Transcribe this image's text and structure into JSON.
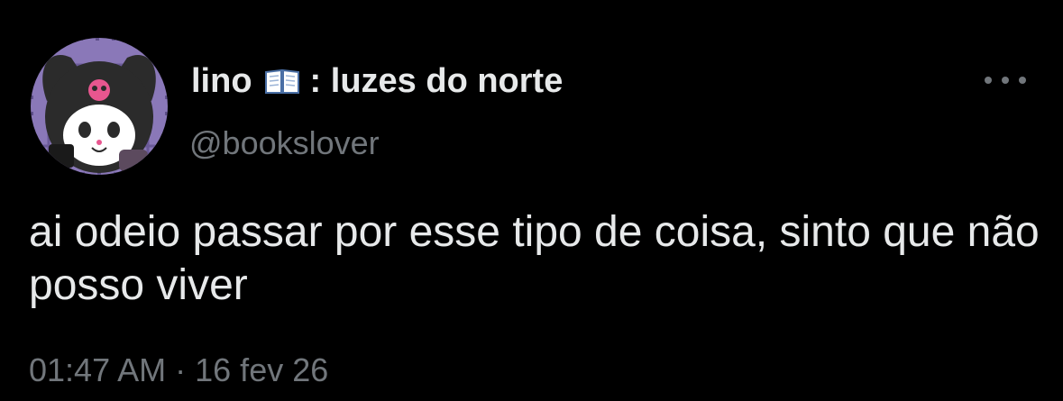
{
  "tweet": {
    "author": {
      "display_name": "lino",
      "name_suffix": ": luzes do norte",
      "name_emoji": "open-book-icon",
      "handle": "@bookslover",
      "avatar": "kuromi-avatar"
    },
    "text": "ai odeio passar por esse tipo de coisa, sinto que não posso viver",
    "time": "01:47 AM",
    "separator": "·",
    "date": "16 fev 26",
    "more_icon": "ellipsis-icon"
  },
  "colors": {
    "background": "#000000",
    "primary_text": "#e7e9ea",
    "secondary_text": "#71767b"
  }
}
